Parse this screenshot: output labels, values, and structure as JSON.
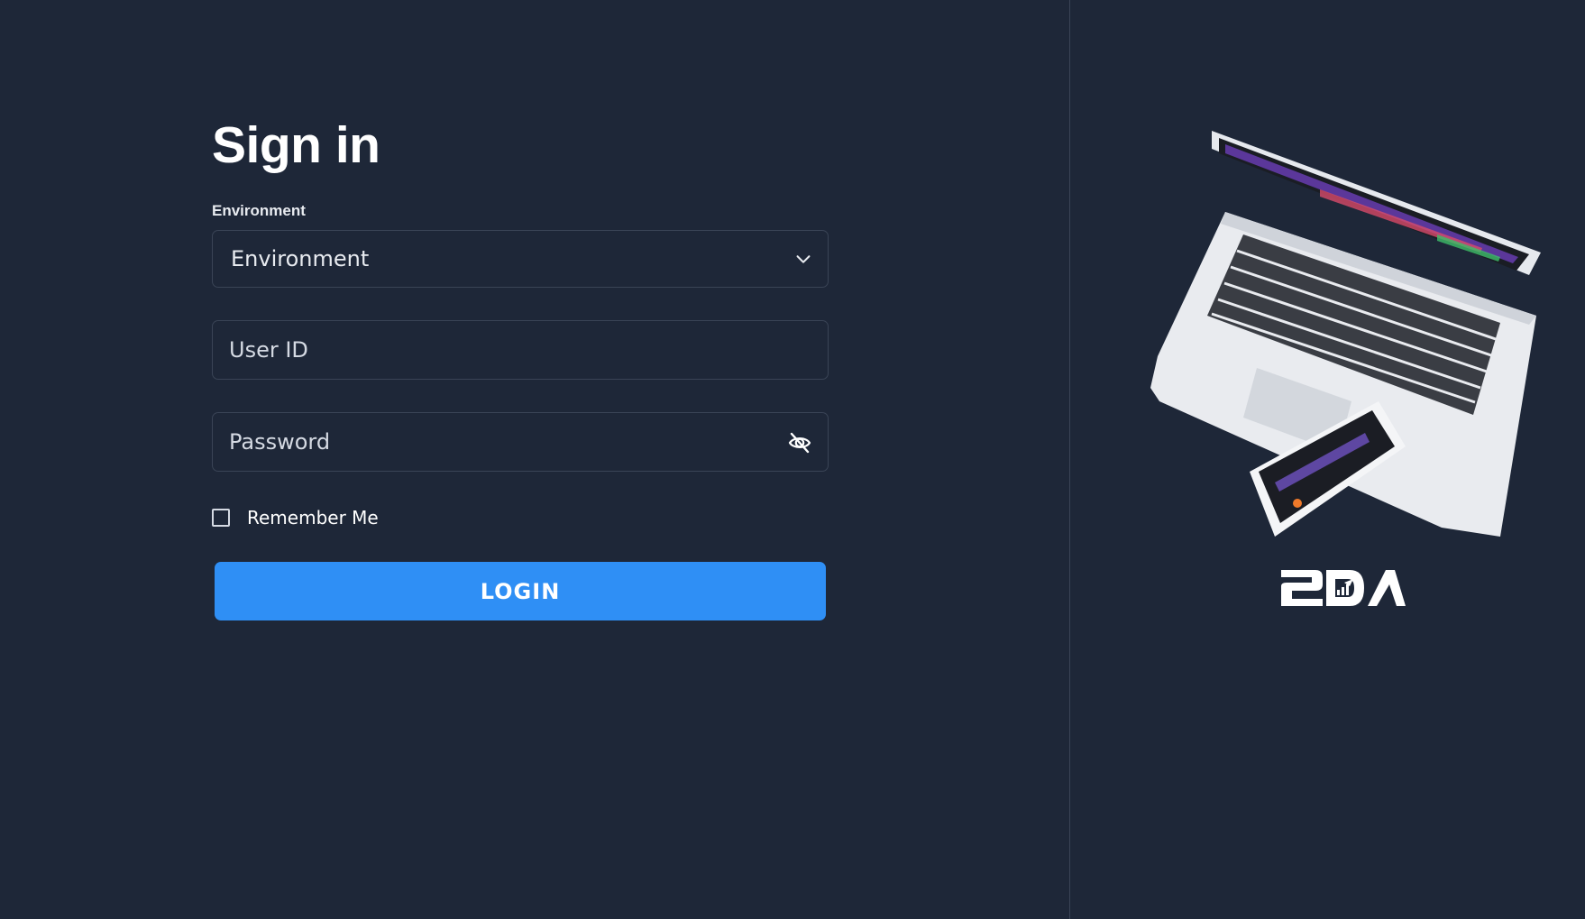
{
  "signin": {
    "title": "Sign in",
    "environment_label": "Environment",
    "environment_value": "Environment",
    "userid_placeholder": "User ID",
    "password_placeholder": "Password",
    "remember_label": "Remember Me",
    "remember_checked": false,
    "login_label": "LOGIN"
  },
  "icons": {
    "environment_dropdown": "chevron-down-icon",
    "password_toggle": "eye-off-icon"
  },
  "colors": {
    "background": "#1e2738",
    "border": "#3a4456",
    "primary_button": "#2f8ff5",
    "text": "#ffffff"
  },
  "brand": {
    "logo_text": "2DA"
  }
}
